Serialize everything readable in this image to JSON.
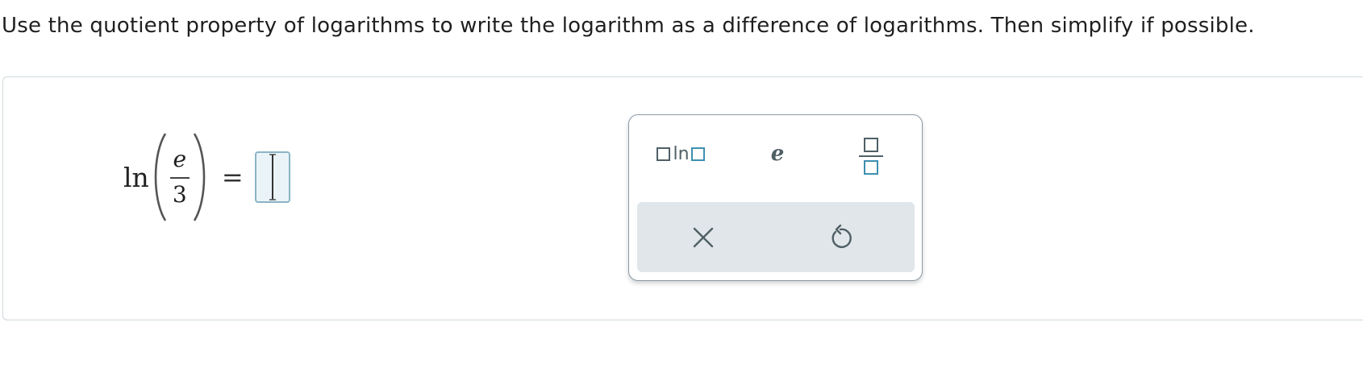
{
  "instructions": "Use the quotient property of logarithms to write the logarithm as a difference of logarithms. Then simplify if possible.",
  "equation": {
    "function": "ln",
    "numerator": "e",
    "denominator": "3",
    "equals": "=",
    "answer_value": ""
  },
  "palette": {
    "ln_button_label": "ln",
    "e_button_label": "e",
    "fraction_button_icon": "fraction-template-icon",
    "clear_button_icon": "close-x-icon",
    "undo_button_icon": "undo-arrow-icon"
  },
  "colors": {
    "accent_blue": "#3e8fb0",
    "icon_gray": "#4f5f66",
    "answer_box_fill": "#eaf4f8",
    "action_bar": "#e0e6e9"
  }
}
